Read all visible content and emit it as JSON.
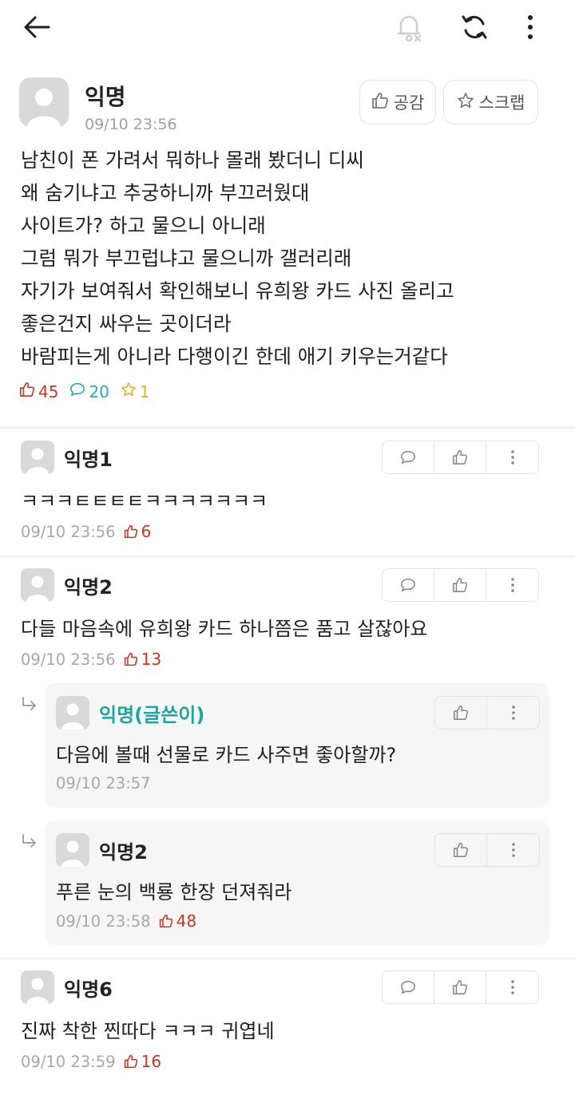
{
  "colors": {
    "accent_red": "#c0392b",
    "accent_blue": "#2aa6c9",
    "accent_yellow": "#e2b21e",
    "op_teal": "#1fa5a0"
  },
  "header": {
    "icons": [
      "back-arrow-icon",
      "notification-off-icon",
      "refresh-icon",
      "more-vertical-icon"
    ]
  },
  "post": {
    "author": "익명",
    "time": "09/10 23:56",
    "like_label": "공감",
    "scrap_label": "스크랩",
    "body_lines": [
      "남친이 폰 가려서 뭐하나 몰래 봤더니 디씨",
      "왜 숨기냐고 추궁하니까 부끄러웠대",
      "사이트가? 하고 물으니 아니래",
      "그럼 뭐가 부끄럽냐고 물으니까 갤러리래",
      "자기가 보여줘서 확인해보니 유희왕 카드 사진 올리고",
      "좋은건지 싸우는 곳이더라",
      "바람피는게 아니라 다행이긴 한데 애기 키우는거같다"
    ],
    "likes": "45",
    "comments": "20",
    "scraps": "1"
  },
  "comments": [
    {
      "author": "익명1",
      "text": "ㅋㅋㅋㅌㅌㅌㅌㅋㅋㅋㅋㅋㅋㅋ",
      "time": "09/10 23:56",
      "votes": "6"
    },
    {
      "author": "익명2",
      "text": "다들 마음속에 유희왕 카드 하나쯤은 품고 살잖아요",
      "time": "09/10 23:56",
      "votes": "13"
    },
    {
      "author": "익명6",
      "text": "진짜 착한 찐따다 ㅋㅋㅋ 귀엽네",
      "time": "09/10 23:59",
      "votes": "16"
    }
  ],
  "replies": [
    {
      "author": "익명(글쓴이)",
      "text": "다음에 볼때 선물로 카드 사주면 좋아할까?",
      "time": "09/10 23:57",
      "votes": ""
    },
    {
      "author": "익명2",
      "text": "푸른 눈의 백룡 한장 던져줘라",
      "time": "09/10 23:58",
      "votes": "48"
    }
  ]
}
